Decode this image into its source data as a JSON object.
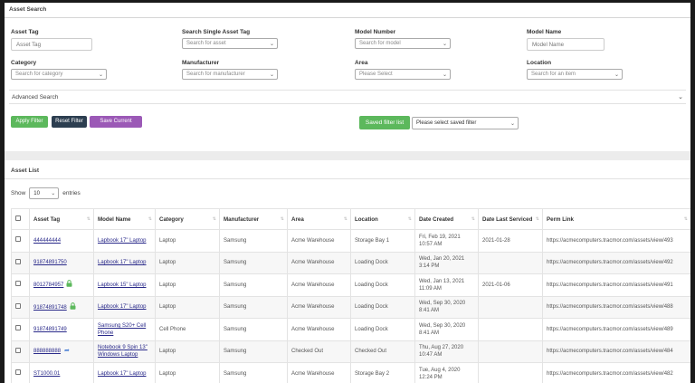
{
  "search": {
    "title": "Asset Search",
    "fields": {
      "asset_tag": {
        "label": "Asset Tag",
        "placeholder": "Asset Tag"
      },
      "single_asset_tag": {
        "label": "Search Single Asset Tag",
        "value": "Search for asset"
      },
      "model_number": {
        "label": "Model Number",
        "value": "Search for model"
      },
      "model_name": {
        "label": "Model Name",
        "placeholder": "Model Name"
      },
      "category": {
        "label": "Category",
        "value": "Search for category"
      },
      "manufacturer": {
        "label": "Manufacturer",
        "value": "Search for manufacturer"
      },
      "area": {
        "label": "Area",
        "value": "Please Select"
      },
      "location": {
        "label": "Location",
        "value": "Search for an item"
      }
    },
    "advanced_label": "Advanced Search",
    "buttons": {
      "apply": "Apply Filter",
      "reset": "Reset Filter",
      "save": "Save Current Filter",
      "saved_list": "Saved filter list"
    },
    "saved_filter_placeholder": "Please select saved filter"
  },
  "asset_list": {
    "title": "Asset List",
    "show_label": "Show",
    "entries_value": "10",
    "entries_label": "entries",
    "columns": [
      "Asset Tag",
      "Model Name",
      "Category",
      "Manufacturer",
      "Area",
      "Location",
      "Date Created",
      "Date Last Serviced",
      "Perm Link"
    ],
    "rows": [
      {
        "tag": "444444444",
        "model": "Lapbook 17\" Laptop",
        "category": "Laptop",
        "manufacturer": "Samsung",
        "area": "Acme Warehouse",
        "location": "Storage Bay 1",
        "created": "Fri, Feb 19, 2021 10:57 AM",
        "serviced": "2021-01-28",
        "link": "https://acmecomputers.tracmor.com/assets/view/493",
        "icon": ""
      },
      {
        "tag": "91874891750",
        "model": "Lapbook 17\" Laptop",
        "category": "Laptop",
        "manufacturer": "Samsung",
        "area": "Acme Warehouse",
        "location": "Loading Dock",
        "created": "Wed, Jan 20, 2021 3:14 PM",
        "serviced": "",
        "link": "https://acmecomputers.tracmor.com/assets/view/492",
        "icon": ""
      },
      {
        "tag": "8012784957",
        "model": "Lapbook 15\" Laptop",
        "category": "Laptop",
        "manufacturer": "Samsung",
        "area": "Acme Warehouse",
        "location": "Loading Dock",
        "created": "Wed, Jan 13, 2021 11:09 AM",
        "serviced": "2021-01-06",
        "link": "https://acmecomputers.tracmor.com/assets/view/491",
        "icon": "lock-icon"
      },
      {
        "tag": "91874891748",
        "model": "Lapbook 17\" Laptop",
        "category": "Laptop",
        "manufacturer": "Samsung",
        "area": "Acme Warehouse",
        "location": "Loading Dock",
        "created": "Wed, Sep 30, 2020 8:41 AM",
        "serviced": "",
        "link": "https://acmecomputers.tracmor.com/assets/view/488",
        "icon": "lock-icon"
      },
      {
        "tag": "91874891749",
        "model": "Samsung S20+ Cell Phone",
        "category": "Cell Phone",
        "manufacturer": "Samsung",
        "area": "Acme Warehouse",
        "location": "Loading Dock",
        "created": "Wed, Sep 30, 2020 8:41 AM",
        "serviced": "",
        "link": "https://acmecomputers.tracmor.com/assets/view/489",
        "icon": ""
      },
      {
        "tag": "888888888",
        "model": "Notebook 9 Spin 13\" Windows Laptop",
        "category": "Laptop",
        "manufacturer": "Samsung",
        "area": "Checked Out",
        "location": "Checked Out",
        "created": "Thu, Aug 27, 2020 10:47 AM",
        "serviced": "",
        "link": "https://acmecomputers.tracmor.com/assets/view/484",
        "icon": "share-icon"
      },
      {
        "tag": "ST1000.01",
        "model": "Lapbook 17\" Laptop",
        "category": "Laptop",
        "manufacturer": "Samsung",
        "area": "Acme Warehouse",
        "location": "Storage Bay 2",
        "created": "Tue, Aug 4, 2020 12:24 PM",
        "serviced": "",
        "link": "https://acmecomputers.tracmor.com/assets/view/482",
        "icon": ""
      }
    ]
  },
  "colors": {
    "apply": "#5cb85c",
    "reset": "#2c3e50",
    "save": "#9b59b6",
    "lock": "#5cb85c",
    "share": "#4a7fd4"
  }
}
